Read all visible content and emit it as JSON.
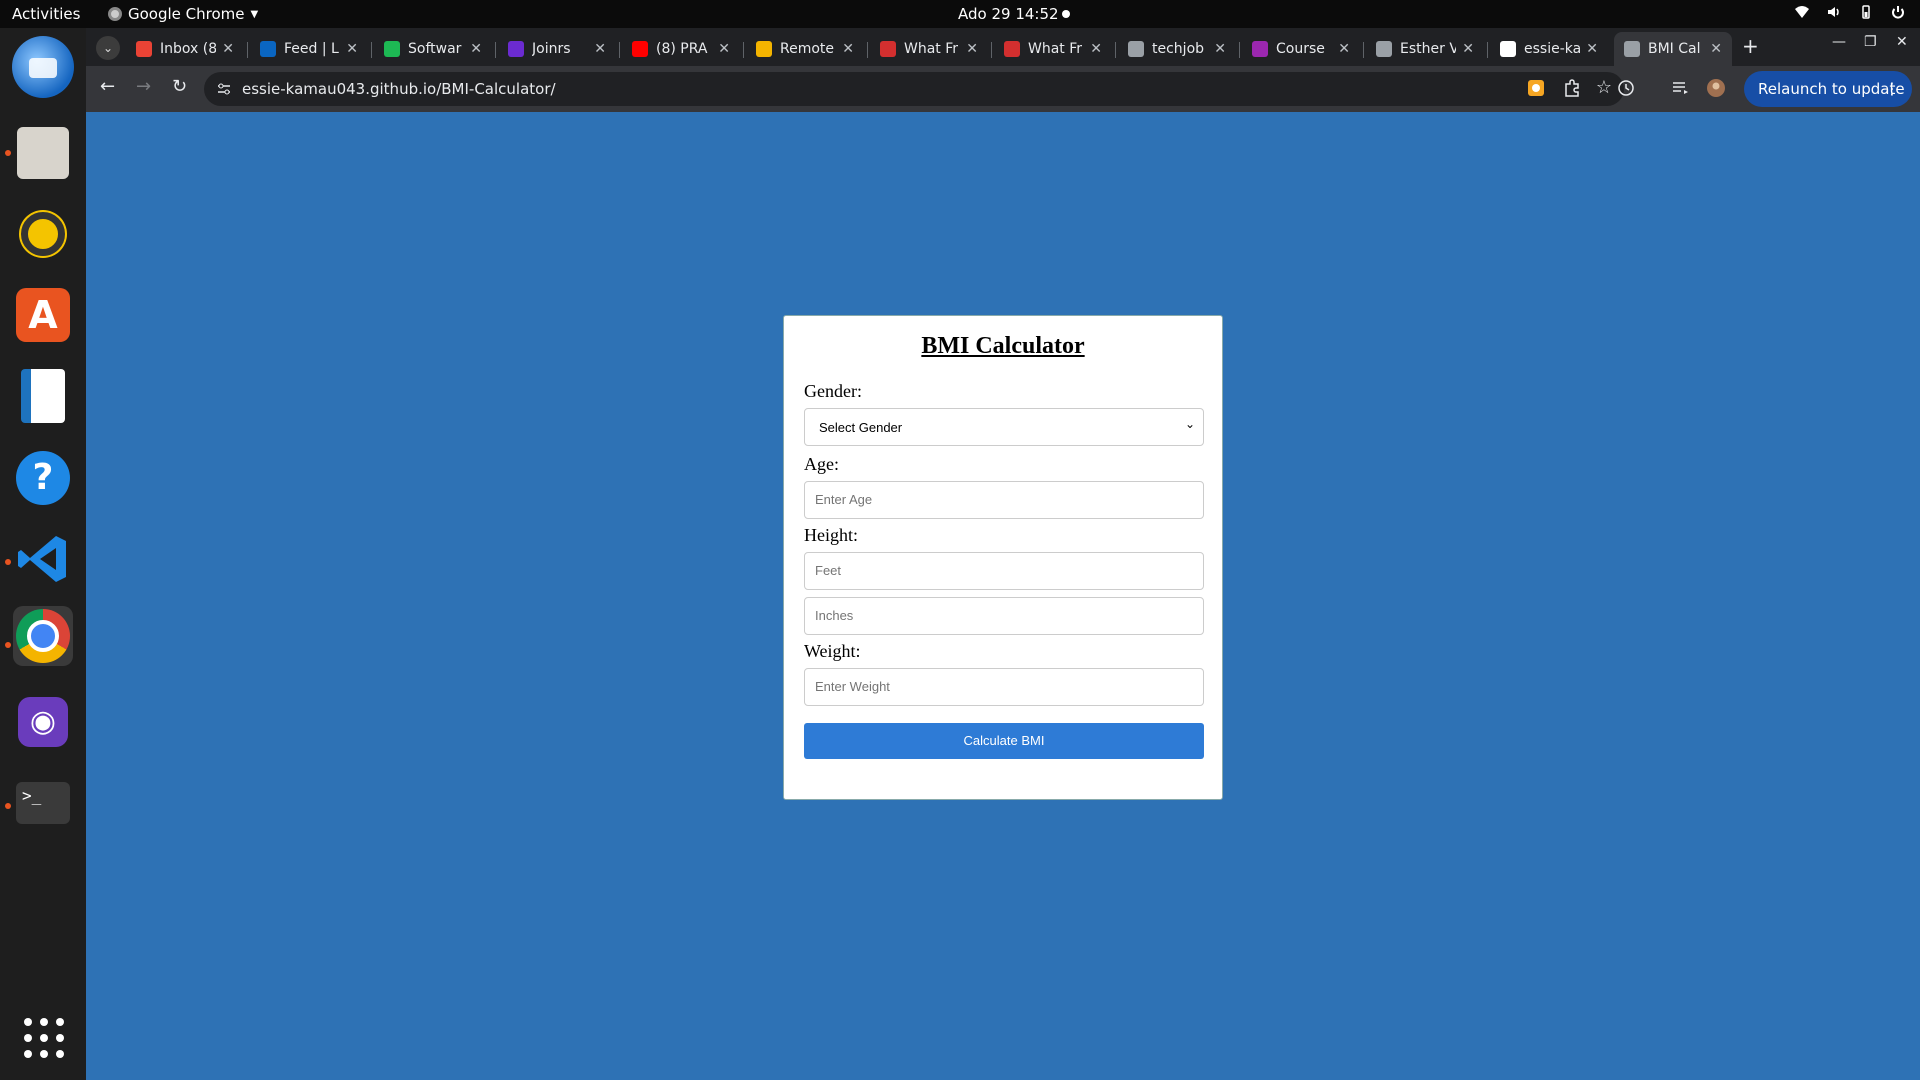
{
  "topbar": {
    "activities": "Activities",
    "app_name": "Google Chrome",
    "clock": "Ado 29  14:52"
  },
  "dock": {
    "apps": [
      "thunderbird-icon",
      "files-icon",
      "rhythmbox-icon",
      "app-center-icon",
      "libreoffice-writer-icon",
      "help-icon",
      "vscode-icon",
      "chrome-icon",
      "github-desktop-icon",
      "terminal-icon",
      "show-apps-icon"
    ]
  },
  "tabs": [
    {
      "label": "Inbox (8",
      "favicon_color": "#ea4335"
    },
    {
      "label": "Feed | L",
      "favicon_color": "#0a66c2"
    },
    {
      "label": "Softwar",
      "favicon_color": "#1db954"
    },
    {
      "label": "Joinrs",
      "favicon_color": "#6b2bd1"
    },
    {
      "label": "(8) PRA",
      "favicon_color": "#ff0000"
    },
    {
      "label": "Remote",
      "favicon_color": "#f4b400"
    },
    {
      "label": "What Fr",
      "favicon_color": "#d32f2f"
    },
    {
      "label": "What Fr",
      "favicon_color": "#d32f2f"
    },
    {
      "label": "techjob",
      "favicon_color": "#9aa0a6"
    },
    {
      "label": "Course",
      "favicon_color": "#9c27b0"
    },
    {
      "label": "Esther V",
      "favicon_color": "#9aa0a6"
    },
    {
      "label": "essie-ka",
      "favicon_color": "#ffffff"
    },
    {
      "label": "BMI Cal",
      "favicon_color": "#9aa0a6"
    }
  ],
  "toolbar": {
    "url": "essie-kamau043.github.io/BMI-Calculator/",
    "relaunch_label": "Relaunch to update"
  },
  "form": {
    "title": "BMI Calculator",
    "gender_label": "Gender:",
    "gender_selected": "Select Gender",
    "age_label": "Age:",
    "age_placeholder": "Enter Age",
    "height_label": "Height:",
    "feet_placeholder": "Feet",
    "inches_placeholder": "Inches",
    "weight_label": "Weight:",
    "weight_placeholder": "Enter Weight",
    "calculate_label": "Calculate BMI"
  },
  "colors": {
    "page_bg": "#2e72b5",
    "button_bg": "#2e7bd6",
    "relaunch_bg": "#174ea6"
  }
}
